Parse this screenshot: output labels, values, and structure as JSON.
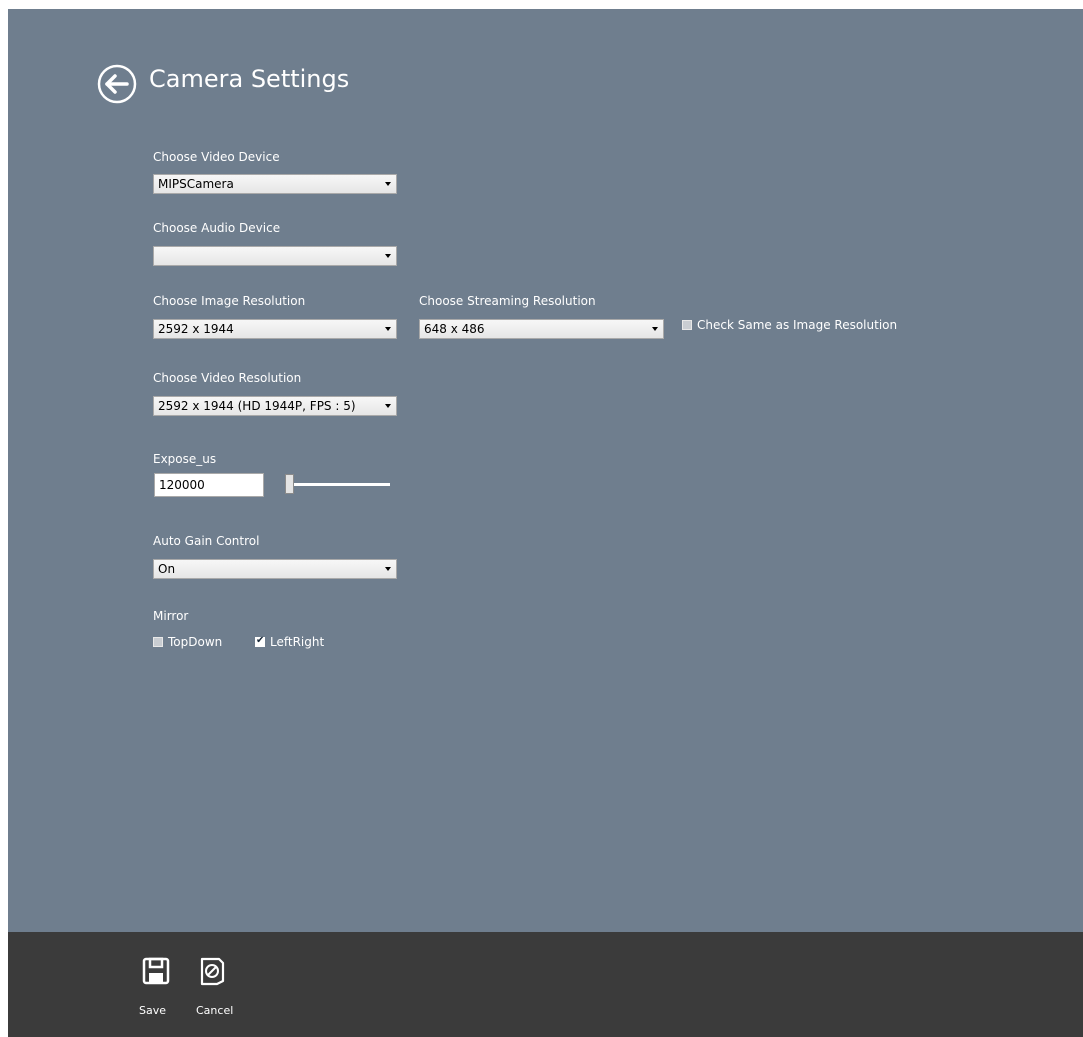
{
  "header": {
    "title": "Camera Settings",
    "back_icon": "arrow-left-circle-icon"
  },
  "video_device": {
    "label": "Choose Video Device",
    "value": "MIPSCamera"
  },
  "audio_device": {
    "label": "Choose Audio Device",
    "value": ""
  },
  "image_resolution": {
    "label": "Choose Image Resolution",
    "value": "2592 x 1944"
  },
  "streaming_resolution": {
    "label": "Choose Streaming Resolution",
    "value": "648 x 486",
    "same_as_image": {
      "label": "Check Same as Image Resolution",
      "checked": false
    }
  },
  "video_resolution": {
    "label": "Choose Video Resolution",
    "value": "2592 x 1944 (HD 1944P, FPS : 5)"
  },
  "exposure": {
    "label": "Expose_us",
    "value": "120000",
    "slider_fraction": 0.0
  },
  "auto_gain": {
    "label": "Auto Gain Control",
    "value": "On"
  },
  "mirror": {
    "label": "Mirror",
    "topdown": {
      "label": "TopDown",
      "checked": false
    },
    "leftright": {
      "label": "LeftRight",
      "checked": true
    }
  },
  "appbar": {
    "save": {
      "label": "Save",
      "icon": "floppy-disk-icon"
    },
    "cancel": {
      "label": "Cancel",
      "icon": "cancel-document-icon"
    }
  },
  "colors": {
    "content_bg": "#6f7e8e",
    "appbar_bg": "#3b3b3b",
    "text": "#ffffff"
  }
}
